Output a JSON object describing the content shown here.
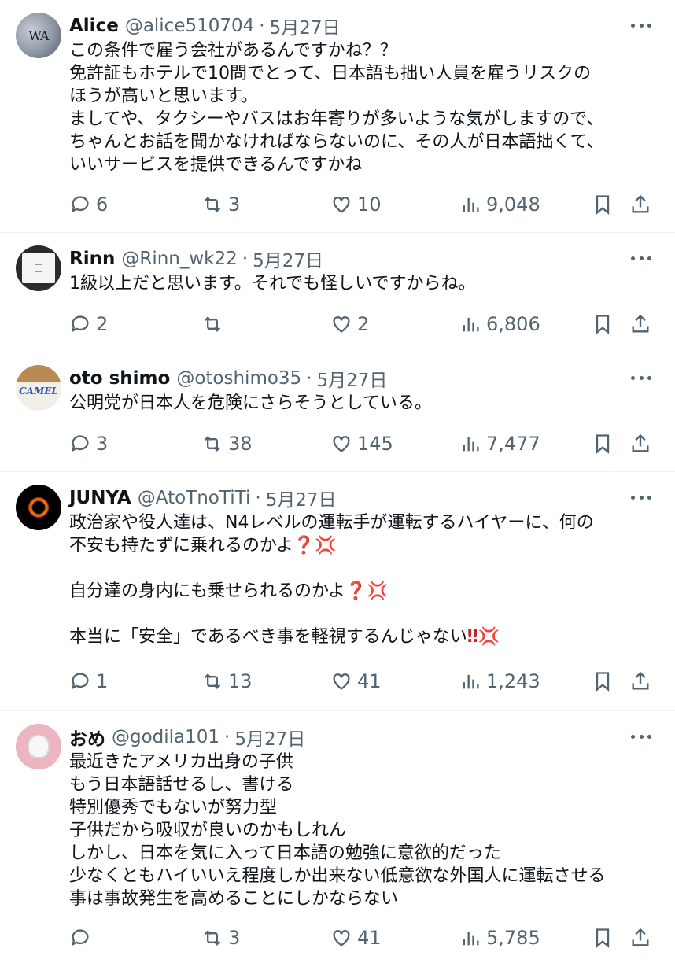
{
  "tweets": [
    {
      "avatar_text": "WA",
      "name": "Alice",
      "handle": "@alice510704",
      "separator": "·",
      "date": "5月27日",
      "lines": [
        "この条件で雇う会社があるんですかね？？",
        "免許証もホテルで10問でとって、日本語も拙い人員を雇うリスクの",
        "ほうが高いと思います。",
        "ましてや、タクシーやバスはお年寄りが多いような気がしますので、",
        "ちゃんとお話を聞かなければならないのに、その人が日本語拙くて、",
        "いいサービスを提供できるんですかね"
      ],
      "replies": "6",
      "retweets": "3",
      "likes": "10",
      "views": "9,048"
    },
    {
      "name": "Rinn",
      "handle": "@Rinn_wk22",
      "separator": "·",
      "date": "5月27日",
      "lines": [
        "1級以上だと思います。それでも怪しいですからね。"
      ],
      "replies": "2",
      "retweets": "",
      "likes": "2",
      "views": "6,806"
    },
    {
      "avatar_text": "CAMEL",
      "name": "oto shimo",
      "handle": "@otoshimo35",
      "separator": "·",
      "date": "5月27日",
      "lines": [
        "公明党が日本人を危険にさらそうとしている。"
      ],
      "replies": "3",
      "retweets": "38",
      "likes": "145",
      "views": "7,477"
    },
    {
      "name": "JUNYA",
      "handle": "@AtoTnoTiTi",
      "separator": "·",
      "date": "5月27日",
      "lines": [
        "政治家や役人達は、N4レベルの運転手が運転するハイヤーに、何の",
        "不安も持たずに乗れるのかよ",
        "",
        "自分達の身内にも乗せられるのかよ",
        "",
        "本当に「安全」であるべき事を軽視するんじゃない"
      ],
      "emoji": {
        "question": "❓",
        "bang": "‼",
        "anger": "💢"
      },
      "replies": "1",
      "retweets": "13",
      "likes": "41",
      "views": "1,243"
    },
    {
      "name": "おめ",
      "handle": "@godila101",
      "separator": "·",
      "date": "5月27日",
      "lines": [
        "最近きたアメリカ出身の子供",
        "もう日本語話せるし、書ける",
        "特別優秀でもないが努力型",
        "子供だから吸収が良いのかもしれん",
        "しかし、日本を気に入って日本語の勉強に意欲的だった",
        "少なくともハイいいえ程度しか出来ない低意欲な外国人に運転させる",
        "事は事故発生を高めることにしかならない"
      ],
      "replies": "",
      "retweets": "3",
      "likes": "41",
      "views": "5,785"
    }
  ],
  "icons": [
    "reply-icon",
    "retweet-icon",
    "like-icon",
    "views-icon",
    "bookmark-icon",
    "share-icon",
    "more-icon"
  ],
  "colors": {
    "text": "#0f1419",
    "secondary": "#536471",
    "divider": "#eff3f4",
    "emoji_red": "#d11e1e"
  }
}
